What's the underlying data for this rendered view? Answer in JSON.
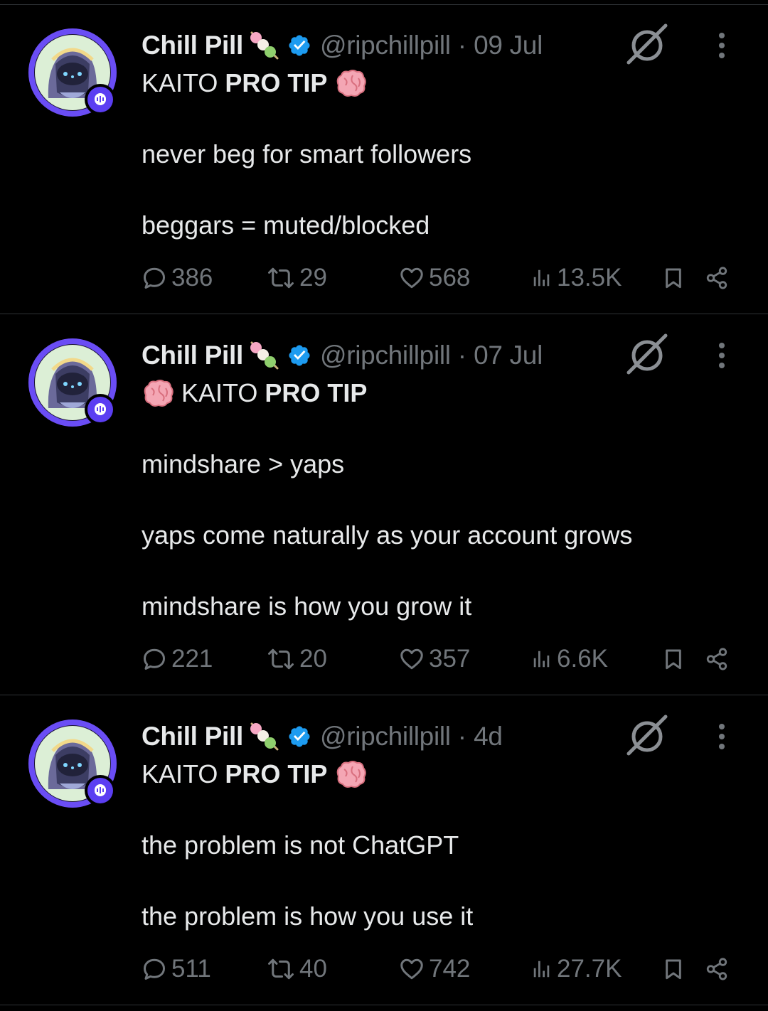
{
  "colors": {
    "background": "#000000",
    "text_primary": "#e7e9ea",
    "text_secondary": "#71767b",
    "verified": "#1d9bf0",
    "avatar_ring": "#6a4df5",
    "divider": "#2f3336"
  },
  "tweets": [
    {
      "author": "Chill Pill",
      "handle": "@ripchillpill",
      "date": "09 Jul",
      "pro_prefix": "KAITO",
      "pro_bold": "PRO TIP",
      "lines": [
        "never beg for smart followers",
        "beggars = muted/blocked"
      ],
      "replies": "386",
      "retweets": "29",
      "likes": "568",
      "views": "13.5K"
    },
    {
      "author": "Chill Pill",
      "handle": "@ripchillpill",
      "date": "07 Jul",
      "pro_prefix": "KAITO",
      "pro_bold": "PRO TIP",
      "lines": [
        "mindshare > yaps",
        "yaps come naturally as your account grows",
        "mindshare is how you grow it"
      ],
      "replies": "221",
      "retweets": "20",
      "likes": "357",
      "views": "6.6K"
    },
    {
      "author": "Chill Pill",
      "handle": "@ripchillpill",
      "date": "4d",
      "pro_prefix": "KAITO",
      "pro_bold": "PRO TIP",
      "lines": [
        "the problem is not ChatGPT",
        "the problem is how you use it"
      ],
      "replies": "511",
      "retweets": "40",
      "likes": "742",
      "views": "27.7K"
    }
  ],
  "icons": {
    "dango": "dango-emoji-icon",
    "verified": "verified-badge-icon",
    "grok": "grok-icon",
    "more": "more-options-icon",
    "brain": "brain-emoji-icon",
    "reply": "reply-icon",
    "retweet": "retweet-icon",
    "like": "heart-icon",
    "views": "views-icon",
    "bookmark": "bookmark-icon",
    "share": "share-icon"
  }
}
